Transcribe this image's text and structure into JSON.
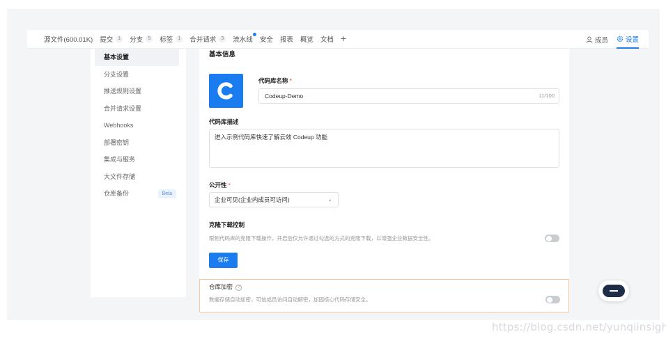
{
  "topbar": {
    "tabs": [
      {
        "label": "源文件(600.01K)",
        "count": ""
      },
      {
        "label": "提交",
        "count": "1"
      },
      {
        "label": "分支",
        "count": "5"
      },
      {
        "label": "标签",
        "count": "1"
      },
      {
        "label": "合并请求",
        "count": "3"
      },
      {
        "label": "流水线",
        "count": ""
      },
      {
        "label": "安全",
        "count": ""
      },
      {
        "label": "报表",
        "count": ""
      },
      {
        "label": "概览",
        "count": ""
      },
      {
        "label": "文档",
        "count": ""
      }
    ],
    "add_icon": "plus-icon",
    "members_label": "成员",
    "settings_label": "设置",
    "accent_color": "#1b7cf0"
  },
  "sidebar": {
    "items": [
      {
        "label": "基本设置"
      },
      {
        "label": "分支设置"
      },
      {
        "label": "推送规则设置"
      },
      {
        "label": "合并请求设置"
      },
      {
        "label": "Webhooks"
      },
      {
        "label": "部署密钥"
      },
      {
        "label": "集成与服务"
      },
      {
        "label": "大文件存储"
      },
      {
        "label": "仓库备份",
        "badge": "Beta"
      }
    ]
  },
  "basic": {
    "section_title": "基本信息",
    "repo_name_label": "代码库名称",
    "repo_name_value": "Codeup-Demo",
    "repo_name_counter": "11/100",
    "desc_label": "代码库描述",
    "desc_value": "进入示例代码库快速了解云效 Codeup 功能",
    "visibility_label": "公开性",
    "visibility_value": "企业可见(企业内成员可访问)",
    "clone_title": "克隆下载控制",
    "clone_desc": "限制代码库的克隆下载操作，开启后仅允许通过勾选的方式的克隆下载，以增强企业数据安全性。",
    "save_label": "保存",
    "required_mark": "*"
  },
  "encryption": {
    "title": "仓库加密",
    "help_icon": "?",
    "desc": "数据存储自动加密，可信成员访问自动解密，加固核心代码存储安全。"
  },
  "watermark": "https://blog.csdn.net/yunqiinsight"
}
